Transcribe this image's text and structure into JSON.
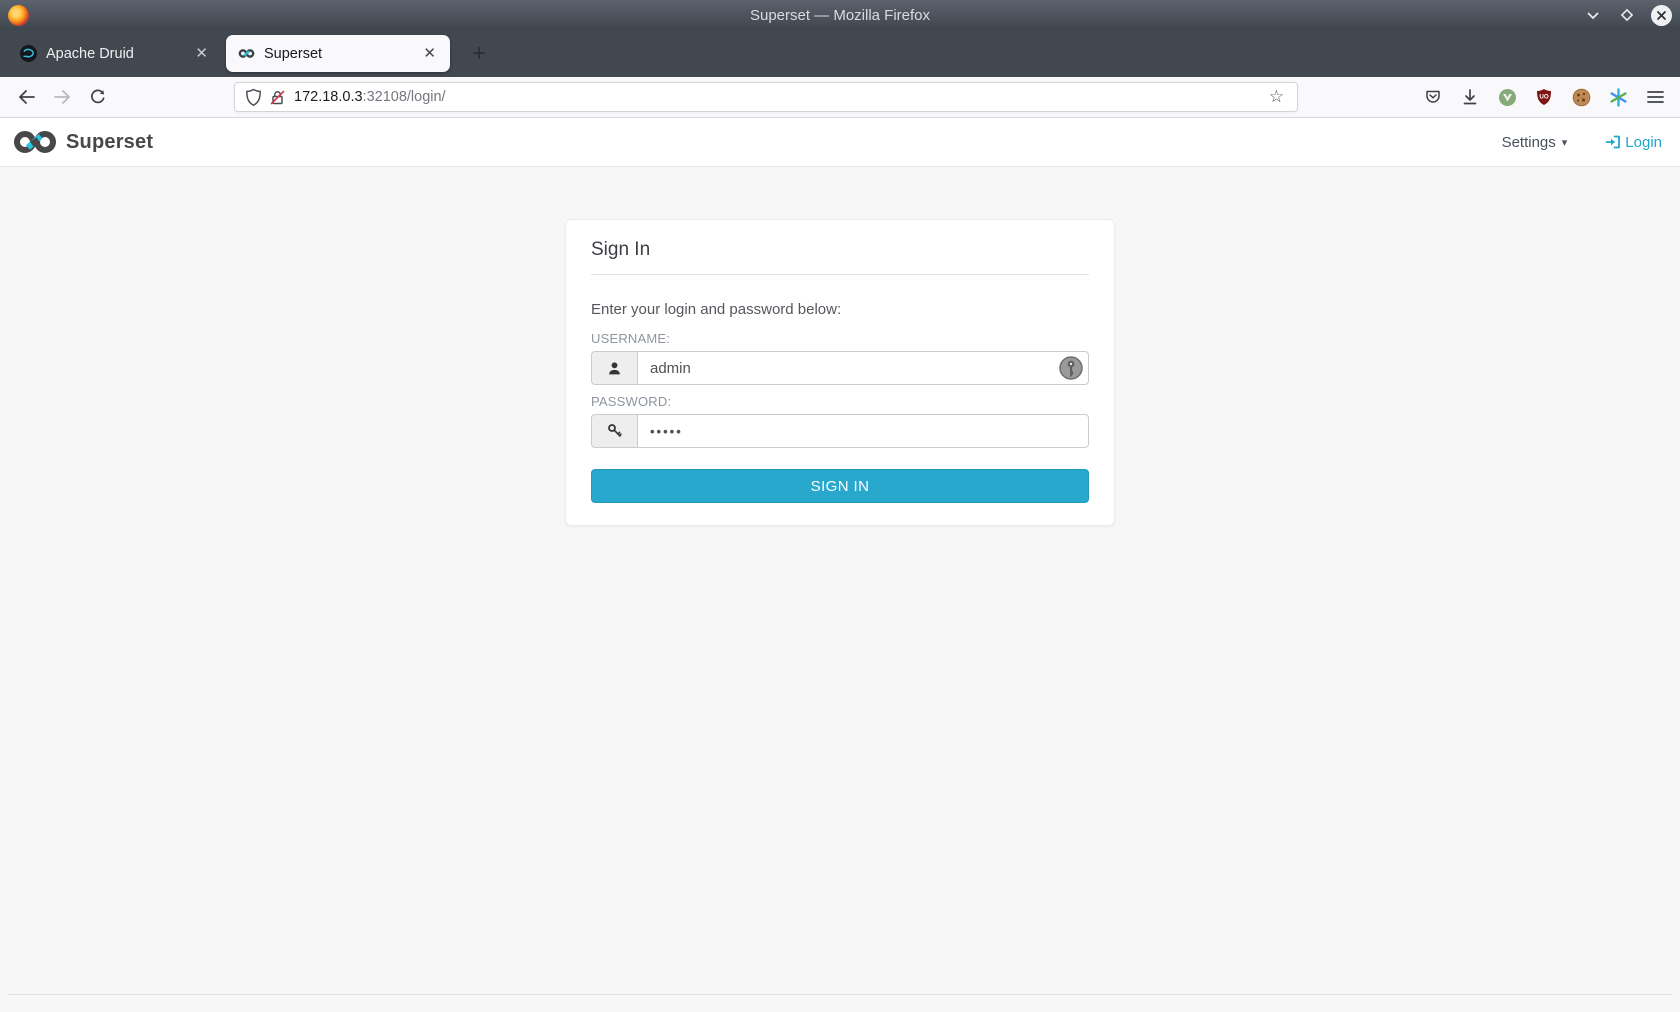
{
  "window": {
    "title": "Superset — Mozilla Firefox"
  },
  "tabs": [
    {
      "label": "Apache Druid",
      "active": false
    },
    {
      "label": "Superset",
      "active": true
    }
  ],
  "urlbar": {
    "host": "172.18.0.3",
    "path": ":32108/login/"
  },
  "app_header": {
    "brand": "Superset",
    "settings_label": "Settings",
    "login_label": "Login"
  },
  "login_card": {
    "title": "Sign In",
    "subtitle": "Enter your login and password below:",
    "username_label": "USERNAME:",
    "username_value": "admin",
    "password_label": "PASSWORD:",
    "password_value": "•••••",
    "submit_label": "SIGN IN"
  },
  "icons": {
    "tab_close": "✕",
    "new_tab": "+",
    "settings_caret": "▾",
    "bookmark_star": "☆"
  },
  "colors": {
    "accent_teal": "#20A7C9",
    "signin_button": "#29A8CD",
    "titlebar": "#474E56",
    "tabbar": "#42484F",
    "toolbar": "#F9F9FB",
    "page_background": "#F7F7F7",
    "ublock_red": "#7F1414"
  }
}
